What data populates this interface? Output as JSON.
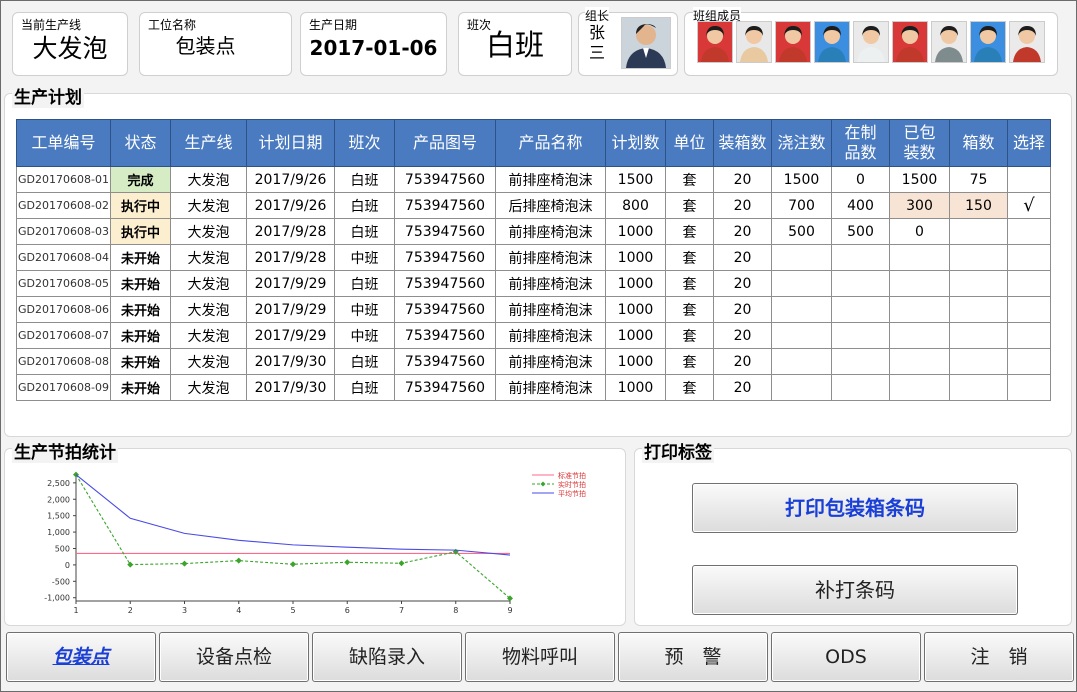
{
  "header": {
    "line": {
      "caption": "当前生产线",
      "value": "大发泡"
    },
    "station": {
      "caption": "工位名称",
      "value": "包装点"
    },
    "date": {
      "caption": "生产日期",
      "value": "2017-01-06"
    },
    "shift": {
      "caption": "班次",
      "value": "白班"
    },
    "leader": {
      "caption": "组长",
      "name": "张三"
    },
    "members": {
      "caption": "班组成员",
      "count": 9
    }
  },
  "plan": {
    "title": "生产计划",
    "columns": [
      "工单编号",
      "状态",
      "生产线",
      "计划日期",
      "班次",
      "产品图号",
      "产品名称",
      "计划数",
      "单位",
      "装箱数",
      "浇注数",
      "在制品数",
      "已包装数",
      "箱数",
      "选择"
    ],
    "rows": [
      {
        "code": "GD20170608-01",
        "status": "完成",
        "line": "大发泡",
        "date": "2017/9/26",
        "shift": "白班",
        "drawing": "753947560",
        "product": "前排座椅泡沫",
        "plan": "1500",
        "unit": "套",
        "box": "20",
        "poured": "1500",
        "wip": "0",
        "packed": "1500",
        "boxes": "75",
        "select": ""
      },
      {
        "code": "GD20170608-02",
        "status": "执行中",
        "line": "大发泡",
        "date": "2017/9/26",
        "shift": "白班",
        "drawing": "753947560",
        "product": "后排座椅泡沫",
        "plan": "800",
        "unit": "套",
        "box": "20",
        "poured": "700",
        "wip": "400",
        "packed": "300",
        "boxes": "150",
        "select": "√"
      },
      {
        "code": "GD20170608-03",
        "status": "执行中",
        "line": "大发泡",
        "date": "2017/9/28",
        "shift": "白班",
        "drawing": "753947560",
        "product": "前排座椅泡沫",
        "plan": "1000",
        "unit": "套",
        "box": "20",
        "poured": "500",
        "wip": "500",
        "packed": "0",
        "boxes": "",
        "select": ""
      },
      {
        "code": "GD20170608-04",
        "status": "未开始",
        "line": "大发泡",
        "date": "2017/9/28",
        "shift": "中班",
        "drawing": "753947560",
        "product": "前排座椅泡沫",
        "plan": "1000",
        "unit": "套",
        "box": "20",
        "poured": "",
        "wip": "",
        "packed": "",
        "boxes": "",
        "select": ""
      },
      {
        "code": "GD20170608-05",
        "status": "未开始",
        "line": "大发泡",
        "date": "2017/9/29",
        "shift": "白班",
        "drawing": "753947560",
        "product": "前排座椅泡沫",
        "plan": "1000",
        "unit": "套",
        "box": "20",
        "poured": "",
        "wip": "",
        "packed": "",
        "boxes": "",
        "select": ""
      },
      {
        "code": "GD20170608-06",
        "status": "未开始",
        "line": "大发泡",
        "date": "2017/9/29",
        "shift": "中班",
        "drawing": "753947560",
        "product": "前排座椅泡沫",
        "plan": "1000",
        "unit": "套",
        "box": "20",
        "poured": "",
        "wip": "",
        "packed": "",
        "boxes": "",
        "select": ""
      },
      {
        "code": "GD20170608-07",
        "status": "未开始",
        "line": "大发泡",
        "date": "2017/9/29",
        "shift": "中班",
        "drawing": "753947560",
        "product": "前排座椅泡沫",
        "plan": "1000",
        "unit": "套",
        "box": "20",
        "poured": "",
        "wip": "",
        "packed": "",
        "boxes": "",
        "select": ""
      },
      {
        "code": "GD20170608-08",
        "status": "未开始",
        "line": "大发泡",
        "date": "2017/9/30",
        "shift": "白班",
        "drawing": "753947560",
        "product": "前排座椅泡沫",
        "plan": "1000",
        "unit": "套",
        "box": "20",
        "poured": "",
        "wip": "",
        "packed": "",
        "boxes": "",
        "select": ""
      },
      {
        "code": "GD20170608-09",
        "status": "未开始",
        "line": "大发泡",
        "date": "2017/9/30",
        "shift": "白班",
        "drawing": "753947560",
        "product": "前排座椅泡沫",
        "plan": "1000",
        "unit": "套",
        "box": "20",
        "poured": "",
        "wip": "",
        "packed": "",
        "boxes": "",
        "select": ""
      }
    ]
  },
  "rhythm": {
    "title": "生产节拍统计"
  },
  "chart_data": {
    "type": "line",
    "x": [
      1,
      2,
      3,
      4,
      5,
      6,
      7,
      8,
      9
    ],
    "xlim": [
      1,
      9
    ],
    "ylim": [
      -1100,
      2800
    ],
    "yticks": [
      -1000,
      -500,
      0,
      500,
      1000,
      1500,
      2000,
      2500
    ],
    "ytick_labels": [
      "-1,000",
      "-500",
      "0",
      "500",
      "1,000",
      "1,500",
      "2,000",
      "2,500"
    ],
    "legend_position": "top-right",
    "series": [
      {
        "name": "标准节拍",
        "color": "#ff6a8a",
        "dash": false,
        "marker": false,
        "values": [
          350,
          350,
          350,
          350,
          350,
          350,
          350,
          350,
          350
        ]
      },
      {
        "name": "实时节拍",
        "color": "#3aa52a",
        "dash": true,
        "marker": true,
        "values": [
          2750,
          10,
          40,
          130,
          20,
          80,
          50,
          400,
          -1020
        ]
      },
      {
        "name": "平均节拍",
        "color": "#4a4ae8",
        "dash": false,
        "marker": false,
        "values": [
          2750,
          1420,
          960,
          750,
          610,
          540,
          480,
          450,
          300
        ]
      }
    ]
  },
  "print": {
    "title": "打印标签",
    "box_button": "打印包装箱条码",
    "reprint_button": "补打条码"
  },
  "nav": {
    "items": [
      "包装点",
      "设备点检",
      "缺陷录入",
      "物料呼叫",
      "预　警",
      "ODS",
      "注　销"
    ]
  }
}
